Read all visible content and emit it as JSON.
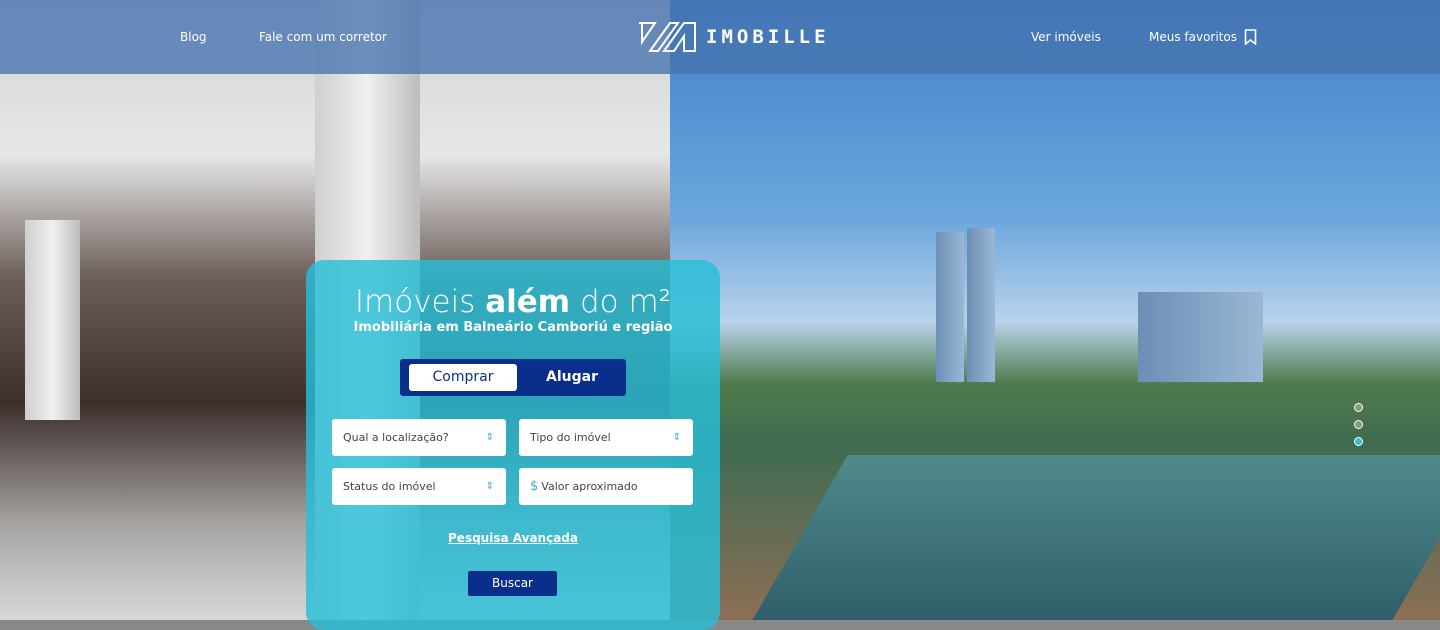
{
  "header": {
    "nav_left": [
      "Blog",
      "Fale com um corretor"
    ],
    "logo_text": "IMOBILLE",
    "nav_right": [
      "Ver imóveis",
      "Meus favoritos"
    ]
  },
  "hero": {
    "title_pre": "Imóveis ",
    "title_bold": "além",
    "title_post": " do m²",
    "subtitle": "Imobiliária em Balneário Camboriú e região",
    "tabs": {
      "buy": "Comprar",
      "rent": "Alugar",
      "active": "Comprar"
    },
    "fields": {
      "location": "Qual a localização?",
      "type": "Tipo do imóvel",
      "status": "Status do imóvel",
      "value": "Valor aproximado",
      "currency": "$"
    },
    "advanced_search": "Pesquisa Avançada",
    "search_button": "Buscar"
  },
  "slider": {
    "count": 3,
    "active": 3
  },
  "colors": {
    "accent": "#0a2f8a",
    "card": "#28bed7",
    "header": "#4673af"
  }
}
